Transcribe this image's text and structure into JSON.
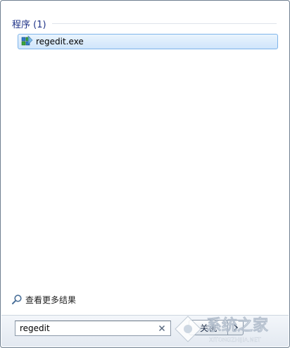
{
  "results_section": {
    "title": "程序 (1)",
    "items": [
      {
        "label": "regedit.exe",
        "icon": "registry-editor-icon"
      }
    ]
  },
  "more_results": {
    "label": "查看更多结果",
    "icon": "search-icon"
  },
  "search": {
    "value": "regedit",
    "clear_icon": "close-icon"
  },
  "shutdown": {
    "label": "关机",
    "arrow_icon": "chevron-right-icon"
  },
  "watermark": {
    "text": "系统之家",
    "url_text": "XITONGZHIJIA.NET"
  },
  "colors": {
    "section_title": "#1e3287",
    "highlight_border": "#7eb4ea",
    "highlight_fill": "#cfe5fb"
  }
}
